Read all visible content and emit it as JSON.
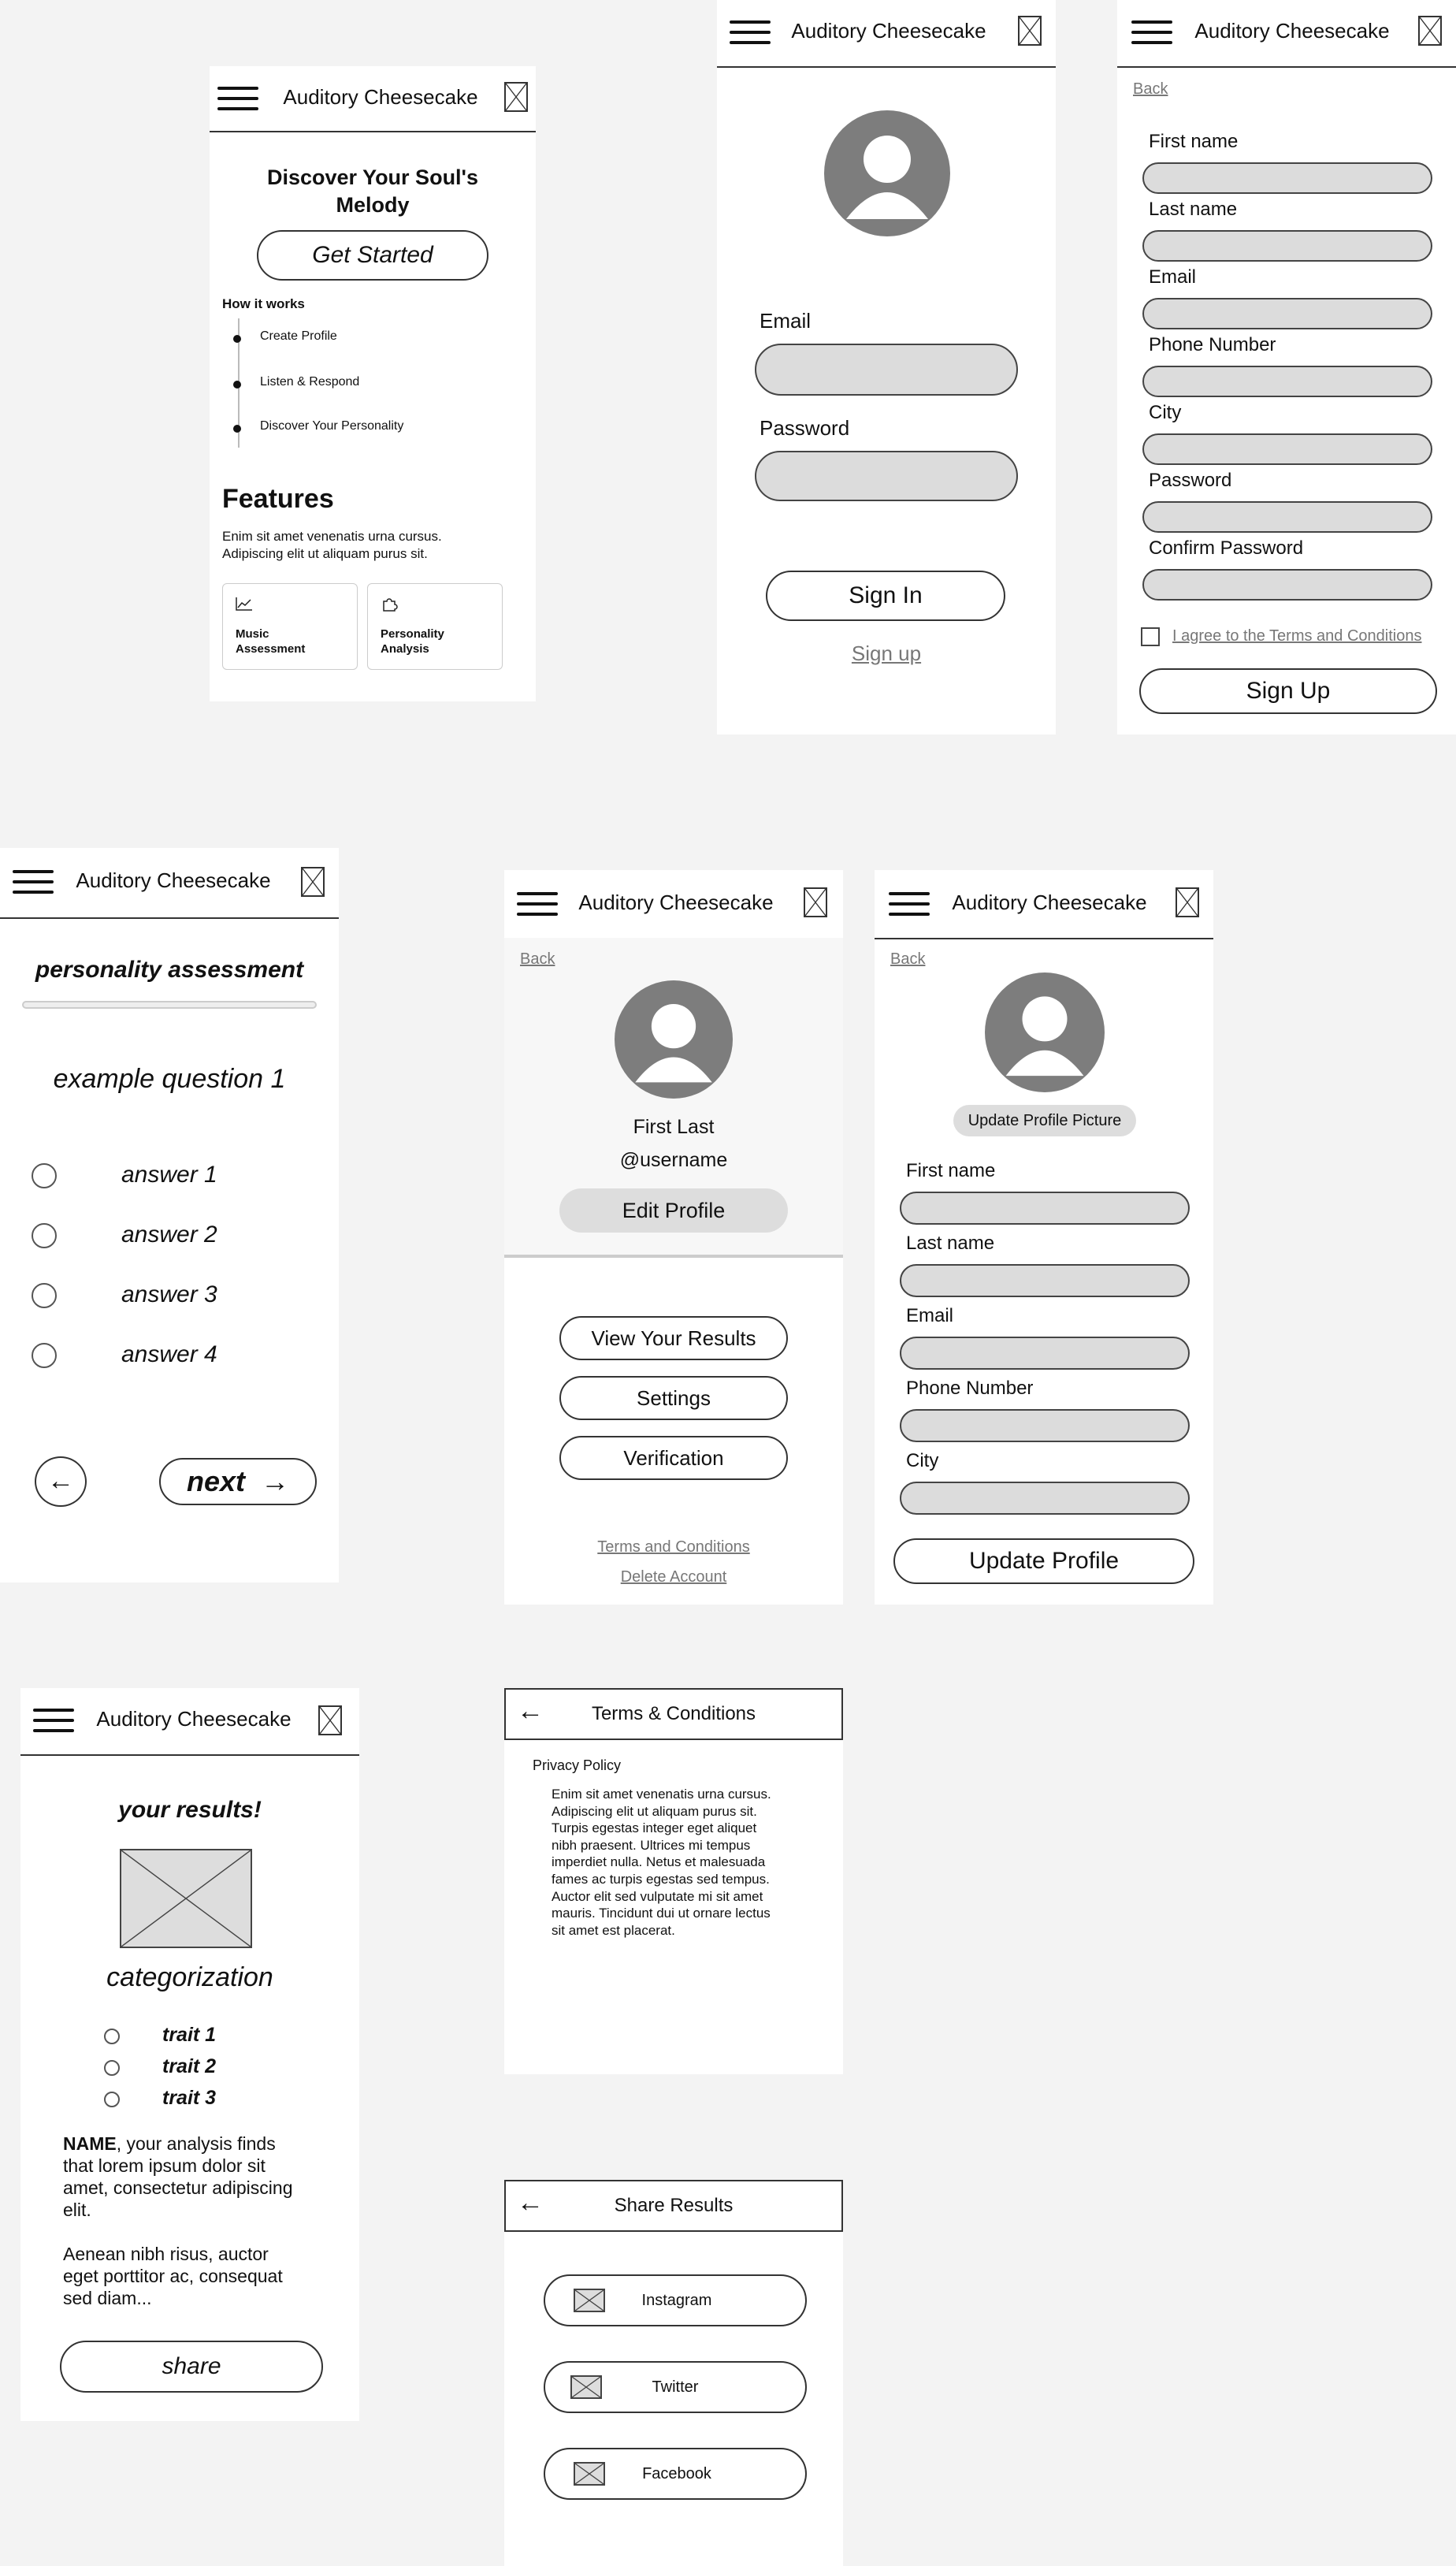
{
  "app": {
    "title": "Auditory Cheesecake"
  },
  "icons": {
    "menu": "menu-icon",
    "image_placeholder": "image-placeholder-icon",
    "back_arrow": "arrow-left-icon",
    "next_arrow": "arrow-right-icon",
    "chart": "chart-line-icon",
    "puzzle": "puzzle-icon",
    "avatar": "user-avatar-icon"
  },
  "landing": {
    "hero_line1": "Discover Your Soul's",
    "hero_line2": "Melody",
    "cta": "Get Started",
    "how_title": "How it works",
    "steps": [
      "Create Profile",
      "Listen & Respond",
      "Discover Your Personality"
    ],
    "features_title": "Features",
    "features_line1": "Enim sit amet venenatis urna cursus.",
    "features_line2": "Adipiscing elit ut aliquam purus sit.",
    "card1_line1": "Music",
    "card1_line2": "Assessment",
    "card2_line1": "Personality",
    "card2_line2": "Analysis"
  },
  "login": {
    "email_label": "Email",
    "password_label": "Password",
    "sign_in": "Sign In",
    "sign_up_link": "Sign up"
  },
  "signup": {
    "back": "Back",
    "fields": [
      "First name",
      "Last name",
      "Email",
      "Phone Number",
      "City",
      "Password",
      "Confirm Password"
    ],
    "agree": "I agree to the Terms and Conditions",
    "submit": "Sign Up"
  },
  "assessment": {
    "title": "personality assessment",
    "question": "example question 1",
    "answers": [
      "answer 1",
      "answer 2",
      "answer 3",
      "answer 4"
    ],
    "back_arrow": "←",
    "next_label": "next",
    "next_arrow": "→",
    "progress": 0
  },
  "profile": {
    "back": "Back",
    "name": "First Last",
    "username": "@username",
    "edit": "Edit Profile",
    "view_results": "View Your Results",
    "settings": "Settings",
    "verification": "Verification",
    "terms": "Terms and Conditions",
    "delete": "Delete Account"
  },
  "edit_profile": {
    "back": "Back",
    "update_picture": "Update Profile Picture",
    "fields": [
      "First name",
      "Last name",
      "Email",
      "Phone Number",
      "City"
    ],
    "submit": "Update Profile"
  },
  "results": {
    "title": "your results!",
    "category": "categorization",
    "traits": [
      "trait 1",
      "trait 2",
      "trait 3"
    ],
    "name_bold": "NAME",
    "para1_lines": [
      ", your analysis finds",
      "that lorem ipsum dolor sit",
      "amet, consectetur adipiscing",
      "elit."
    ],
    "para2_lines": [
      "Aenean nibh risus, auctor",
      "eget porttitor ac, consequat",
      "sed diam..."
    ],
    "share": "share"
  },
  "terms": {
    "back_arrow": "←",
    "title": "Terms & Conditions",
    "section": "Privacy Policy",
    "body_lines": [
      "Enim sit amet venenatis urna cursus.",
      "Adipiscing elit ut aliquam purus sit.",
      "Turpis egestas integer eget aliquet",
      "nibh praesent. Ultrices mi tempus",
      "imperdiet nulla. Netus et malesuada",
      "fames ac turpis egestas sed tempus.",
      "Auctor elit sed vulputate mi sit amet",
      "mauris. Tincidunt dui ut ornare lectus",
      "sit amet est placerat."
    ]
  },
  "share": {
    "back_arrow": "←",
    "title": "Share Results",
    "buttons": [
      "Instagram",
      "Twitter",
      "Facebook"
    ]
  }
}
